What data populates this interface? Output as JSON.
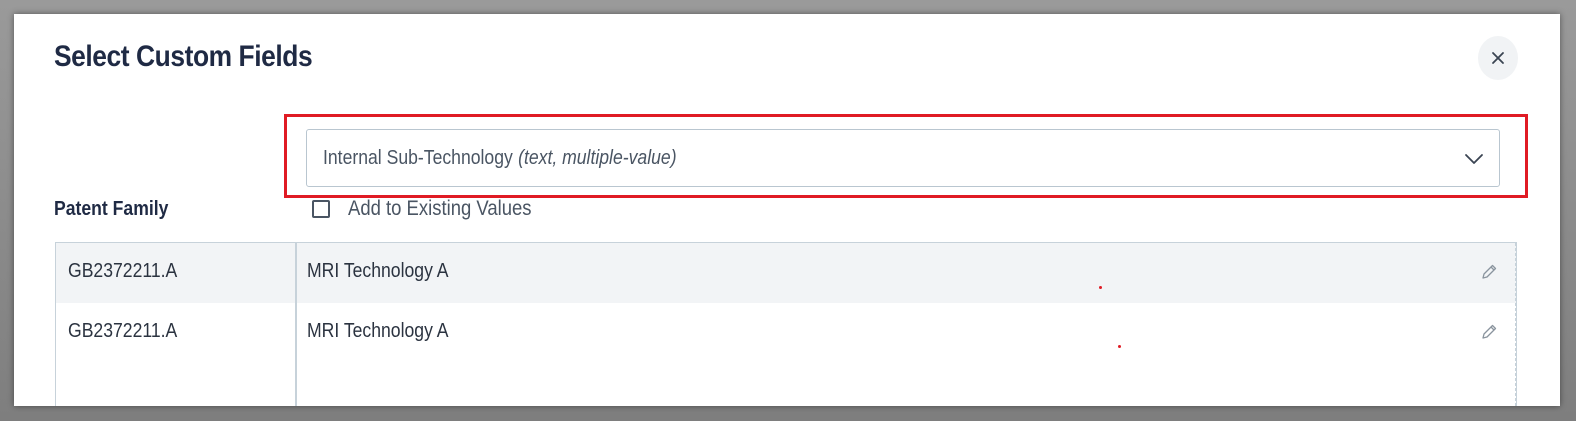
{
  "dialog": {
    "title": "Select Custom Fields",
    "close_icon": "close-icon"
  },
  "field_select": {
    "selected_name": "Internal Sub-Technology",
    "selected_type": "(text, multiple-value)",
    "chevron_icon": "chevron-down-icon"
  },
  "highlight_color": "#e01b24",
  "patent_family_label": "Patent Family",
  "add_to_existing": {
    "label": "Add to Existing Values",
    "checked": false
  },
  "table": {
    "rows": [
      {
        "patent_family": "GB2372211.A",
        "value": "MRI Technology A",
        "edit_icon": "pencil-icon"
      },
      {
        "patent_family": "GB2372211.A",
        "value": "MRI Technology A",
        "edit_icon": "pencil-icon"
      }
    ]
  }
}
